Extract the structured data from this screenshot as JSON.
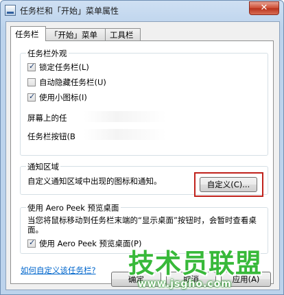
{
  "window": {
    "title": "任务栏和「开始」菜单属性",
    "close_glyph": "✕"
  },
  "tabs": [
    {
      "label": "任务栏",
      "active": true
    },
    {
      "label": "「开始」菜单",
      "active": false
    },
    {
      "label": "工具栏",
      "active": false
    }
  ],
  "appearance": {
    "title": "任务栏外观",
    "lock_label": "锁定任务栏(L)",
    "lock_checked": true,
    "autohide_label": "自动隐藏任务栏(U)",
    "autohide_checked": false,
    "small_icons_label": "使用小图标(I)",
    "small_icons_checked": true,
    "location_label": "屏幕上的任",
    "buttons_label": "任务栏按钮(B"
  },
  "notification": {
    "title": "通知区域",
    "description": "自定义通知区域中出现的图标和通知。",
    "customize_label": "自定义(C)..."
  },
  "aero_peek": {
    "title": "使用 Aero Peek 预览桌面",
    "description": "当您将鼠标移动到任务栏末端的“显示桌面”按钮时，会暂时查看桌面。",
    "checkbox_label": "使用 Aero Peek 预览桌面(P)",
    "checked": true
  },
  "help_link": "如何自定义该任务栏?",
  "buttons": {
    "ok": "确定",
    "cancel": "取消",
    "apply": "应用(A)"
  },
  "watermark": {
    "text": "技术员联盟",
    "url": "www.jsgho.com"
  }
}
